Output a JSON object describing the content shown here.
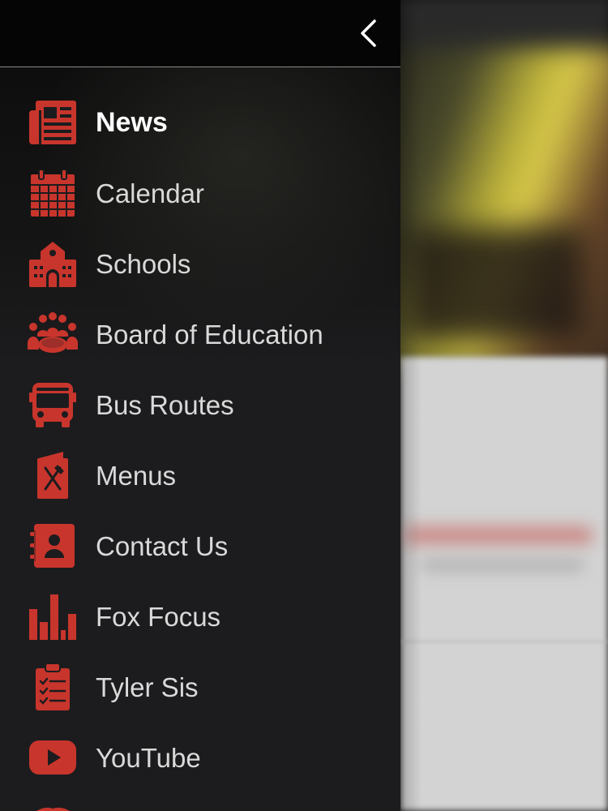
{
  "drawer": {
    "back_icon": "chevron-left-icon",
    "items": [
      {
        "label": "News",
        "icon": "newspaper-icon",
        "active": true
      },
      {
        "label": "Calendar",
        "icon": "calendar-icon",
        "active": false
      },
      {
        "label": "Schools",
        "icon": "school-icon",
        "active": false
      },
      {
        "label": "Board of Education",
        "icon": "group-meeting-icon",
        "active": false
      },
      {
        "label": "Bus Routes",
        "icon": "bus-icon",
        "active": false
      },
      {
        "label": "Menus",
        "icon": "menu-utensils-icon",
        "active": false
      },
      {
        "label": "Contact Us",
        "icon": "contact-book-icon",
        "active": false
      },
      {
        "label": "Fox Focus",
        "icon": "bar-chart-icon",
        "active": false
      },
      {
        "label": "Tyler Sis",
        "icon": "clipboard-checklist-icon",
        "active": false
      },
      {
        "label": "YouTube",
        "icon": "youtube-icon",
        "active": false
      }
    ]
  },
  "colors": {
    "accent": "#c8352c",
    "drawer_bg": "#1c1c1e",
    "header_bg": "#050505",
    "label": "#d9d9d9",
    "label_active": "#ffffff"
  }
}
